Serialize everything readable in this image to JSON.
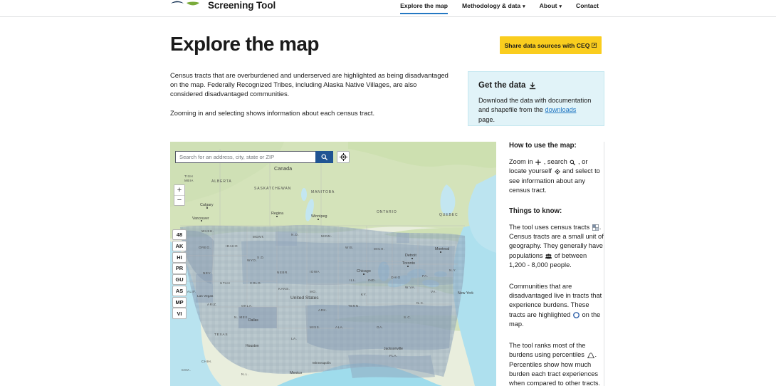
{
  "brand": {
    "title": "Climate and Economic Justice\nScreening Tool",
    "logo_icon": "cejst-waves-logo"
  },
  "nav": {
    "items": [
      {
        "label": "Explore the map",
        "active": true,
        "has_caret": false
      },
      {
        "label": "Methodology & data",
        "active": false,
        "has_caret": true,
        "caret_icon": "chevron-down-icon"
      },
      {
        "label": "About",
        "active": false,
        "has_caret": true,
        "caret_icon": "chevron-down-icon"
      },
      {
        "label": "Contact",
        "active": false,
        "has_caret": false
      }
    ],
    "active_underline_color": "#2378c3"
  },
  "page_title": "Explore the map",
  "share_button": {
    "label": "Share data sources with CEQ",
    "external_icon": "external-link-icon",
    "background": "#facd1e",
    "text_color": "#1b1b1b"
  },
  "intro": {
    "paragraph_1": "Census tracts that are overburdened and underserved are highlighted as being disadvantaged on the map. Federally Recognized Tribes, including Alaska Native Villages, are also considered disadvantaged communities.",
    "paragraph_2": "Zooming in and selecting shows information about each census tract."
  },
  "get_data_panel": {
    "heading": "Get the data",
    "download_icon": "download-icon",
    "text_before_link": "Download the data with documentation and shapefile from the ",
    "link_label": "downloads",
    "text_after_link": " page.",
    "background": "#e1f3f8",
    "link_color": "#2378c3"
  },
  "map": {
    "search": {
      "placeholder": "Search for an address, city, state or ZIP",
      "value": "",
      "button_icon": "search-icon",
      "button_color": "#205493"
    },
    "locate_button": {
      "icon": "locate-me-icon",
      "label": ""
    },
    "zoom_controls": {
      "zoom_in": "+",
      "zoom_out": "−"
    },
    "territories": [
      {
        "label": "48"
      },
      {
        "label": "AK"
      },
      {
        "label": "HI"
      },
      {
        "label": "PR"
      },
      {
        "label": "GU"
      },
      {
        "label": "AS"
      },
      {
        "label": "MP"
      },
      {
        "label": "VI"
      }
    ],
    "labels": {
      "countries": [
        "Canada",
        "United States",
        "Mexico"
      ],
      "provinces": [
        "ALBERTA",
        "SASKATCHEWAN",
        "MANITOBA",
        "ONTARIO",
        "QUEBEC"
      ],
      "cities": [
        "Vancouver",
        "Calgary",
        "Regina",
        "Winnipeg",
        "Toronto",
        "Montreal",
        "Detroit",
        "Chicago",
        "New York",
        "Houston",
        "Dallas",
        "Jacksonville",
        "Minneapolis",
        "Las Vegas"
      ],
      "states": [
        "WASH.",
        "OREG.",
        "IDAHO",
        "MONT.",
        "N.D.",
        "MINN.",
        "WIS.",
        "MICH.",
        "NEBR.",
        "IOWA",
        "ILL.",
        "IND.",
        "OHIO",
        "PA.",
        "N.Y.",
        "MO.",
        "KY.",
        "W. VA.",
        "VA.",
        "TENN.",
        "N.C.",
        "S.C.",
        "ARK.",
        "OKLA.",
        "MISS.",
        "ALA.",
        "GA.",
        "LA.",
        "TEXAS",
        "FLA.",
        "UTAH",
        "COLO.",
        "N. MEX.",
        "ARIZ.",
        "NEV.",
        "CALIF.",
        "WYO.",
        "S.D.",
        "KANS.",
        "COAH.",
        "MD."
      ]
    },
    "colors": {
      "land": "#e8eddc",
      "forest": "#cfe0b5",
      "water": "#b9e3ef",
      "highlight_tract": "#8aa0b8",
      "border": "#b9b9b9"
    }
  },
  "sidebar": {
    "how_to_heading": "How to use the map:",
    "how_to_text_1": "Zoom in ",
    "how_to_icon_1": "plus-icon",
    "how_to_text_2": " , search ",
    "how_to_icon_2": "search-icon",
    "how_to_text_3": " , or locate yourself ",
    "how_to_icon_3": "locate-me-icon",
    "how_to_text_4": " and select to see information about any census tract.",
    "things_heading": "Things to know:",
    "things_1_text_a": "The tool uses census tracts ",
    "things_1_icon": "census-tract-icon",
    "things_1_text_b": ". Census tracts are a small unit of geography. They generally have populations ",
    "things_1_icon_2": "population-icon",
    "things_1_text_c": " of between 1,200 - 8,000 people.",
    "things_2_text_a": "Communities that are disadvantaged live in tracts that experience burdens. These tracts are highlighted ",
    "things_2_icon": "highlight-circle-icon",
    "things_2_text_b": " on the map.",
    "things_3_text_a": "The tool ranks most of the burdens using percentiles ",
    "things_3_icon": "bell-curve-icon",
    "things_3_text_b": ". Percentiles show how much burden each tract experiences when compared to other tracts."
  }
}
